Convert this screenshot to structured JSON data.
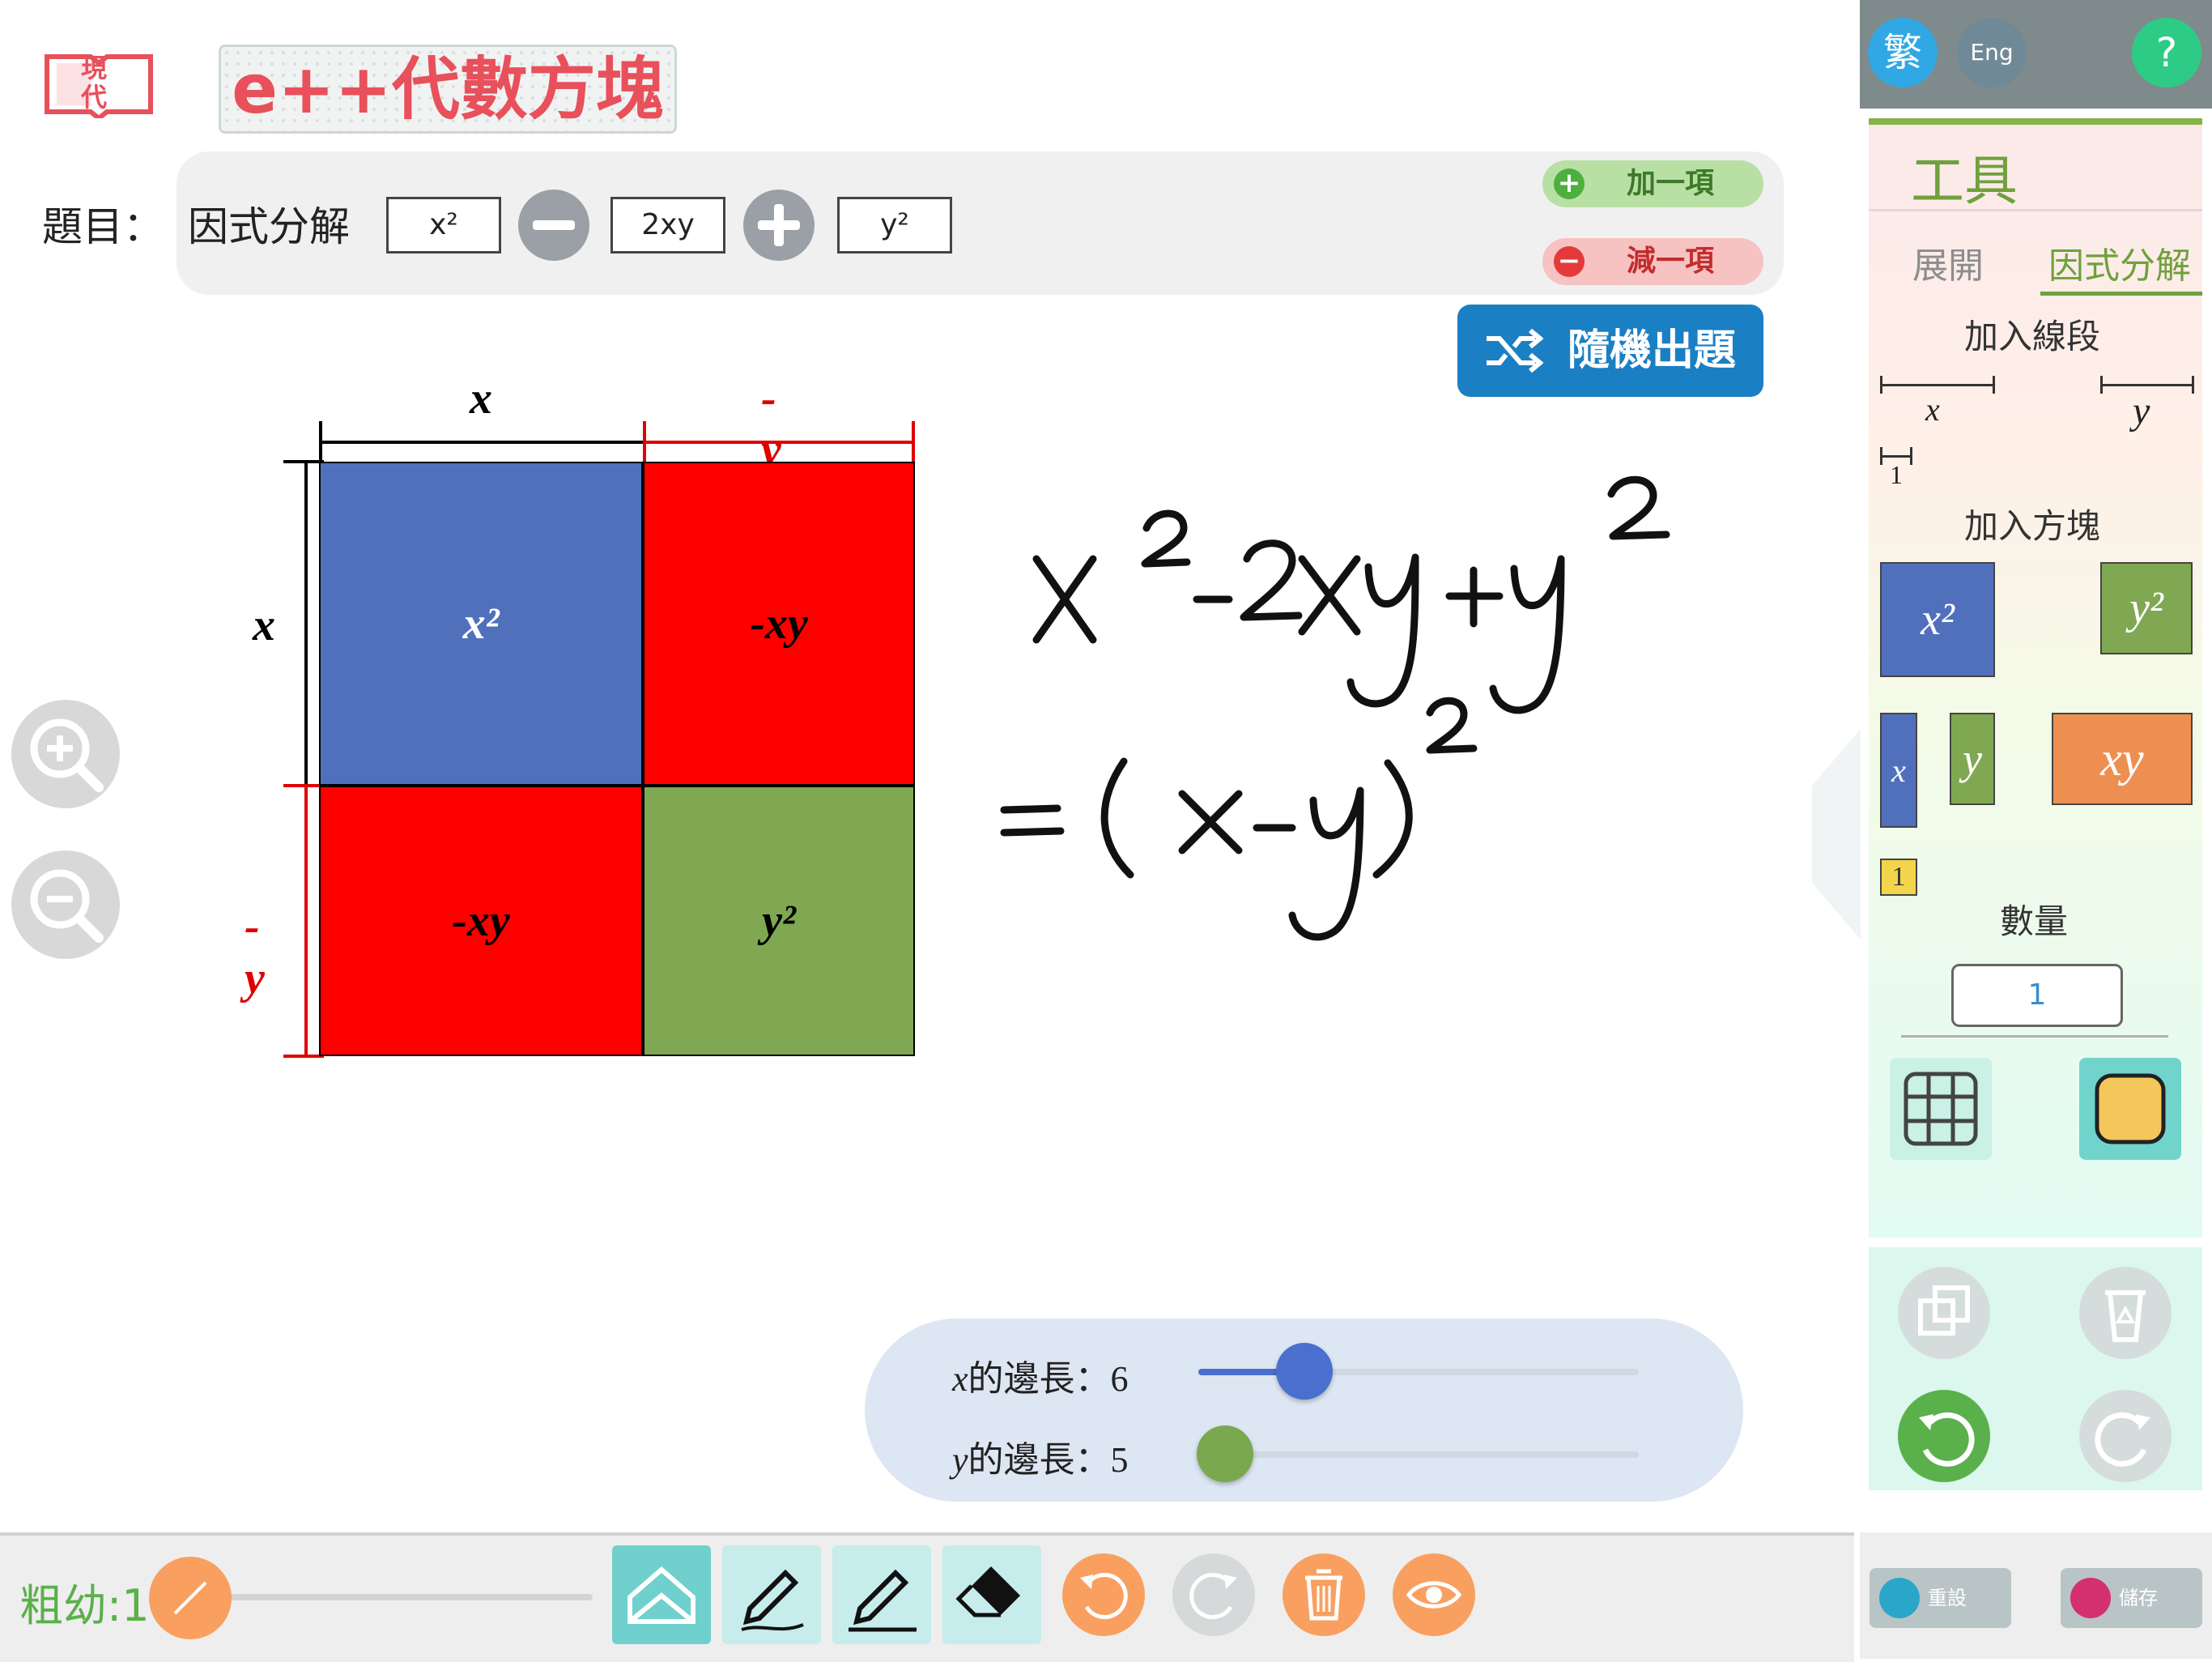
{
  "header": {
    "logo_text": "現代",
    "brand": "e++代數方塊"
  },
  "question": {
    "label": "題目：",
    "type": "因式分解",
    "terms": [
      "x²",
      "2xy",
      "y²"
    ],
    "signs": [
      "minus",
      "plus"
    ],
    "add_term": "加一項",
    "remove_term": "減一項",
    "random_button": "隨機出題"
  },
  "canvas": {
    "top_labels": [
      "x",
      "-y"
    ],
    "left_labels": [
      "x",
      "-y"
    ],
    "tiles": [
      {
        "label": "x²",
        "color": "#5170bc"
      },
      {
        "label": "-xy",
        "color": "#ff0000"
      },
      {
        "label": "-xy",
        "color": "#ff0000"
      },
      {
        "label": "y²",
        "color": "#80a852"
      }
    ],
    "handwriting": [
      "x²-2xy+y²",
      "=(x-y)²"
    ]
  },
  "sliders": [
    {
      "label": "的邊長：6",
      "var": "x",
      "value": 6,
      "fraction": 0.24,
      "color": "#4a6fcf"
    },
    {
      "label": "的邊長：5",
      "var": "y",
      "value": 5,
      "fraction": 0.06,
      "color": "#7aa84e"
    }
  ],
  "language": {
    "traditional": "繁",
    "english": "Eng",
    "help": "?"
  },
  "tools": {
    "title": "工具",
    "tabs": [
      "展開",
      "因式分解"
    ],
    "active_tab": "因式分解",
    "add_segment": "加入線段",
    "segments": [
      "x",
      "y",
      "1"
    ],
    "add_block": "加入方塊",
    "blocks": [
      "x²",
      "y²",
      "x",
      "y",
      "xy",
      "1"
    ],
    "quantity_label": "數量",
    "quantity_value": "1"
  },
  "footer": {
    "reset": "重設",
    "save": "儲存"
  },
  "toolbar": {
    "thickness_label": "粗幼:1",
    "icons": [
      "background-icon",
      "pencil-icon",
      "pen-icon",
      "eraser-icon",
      "undo-icon",
      "redo-icon",
      "trash-icon",
      "eye-icon"
    ]
  },
  "colors": {
    "blue_tile": "#5170bc",
    "red_tile": "#ff0000",
    "green_tile": "#80a852",
    "orange_tile": "#ee8f52",
    "brand_red": "#e8505b",
    "random_blue": "#1b7fc4",
    "accent_green": "#5ab04a",
    "toolbar_orange": "#f9a060"
  }
}
